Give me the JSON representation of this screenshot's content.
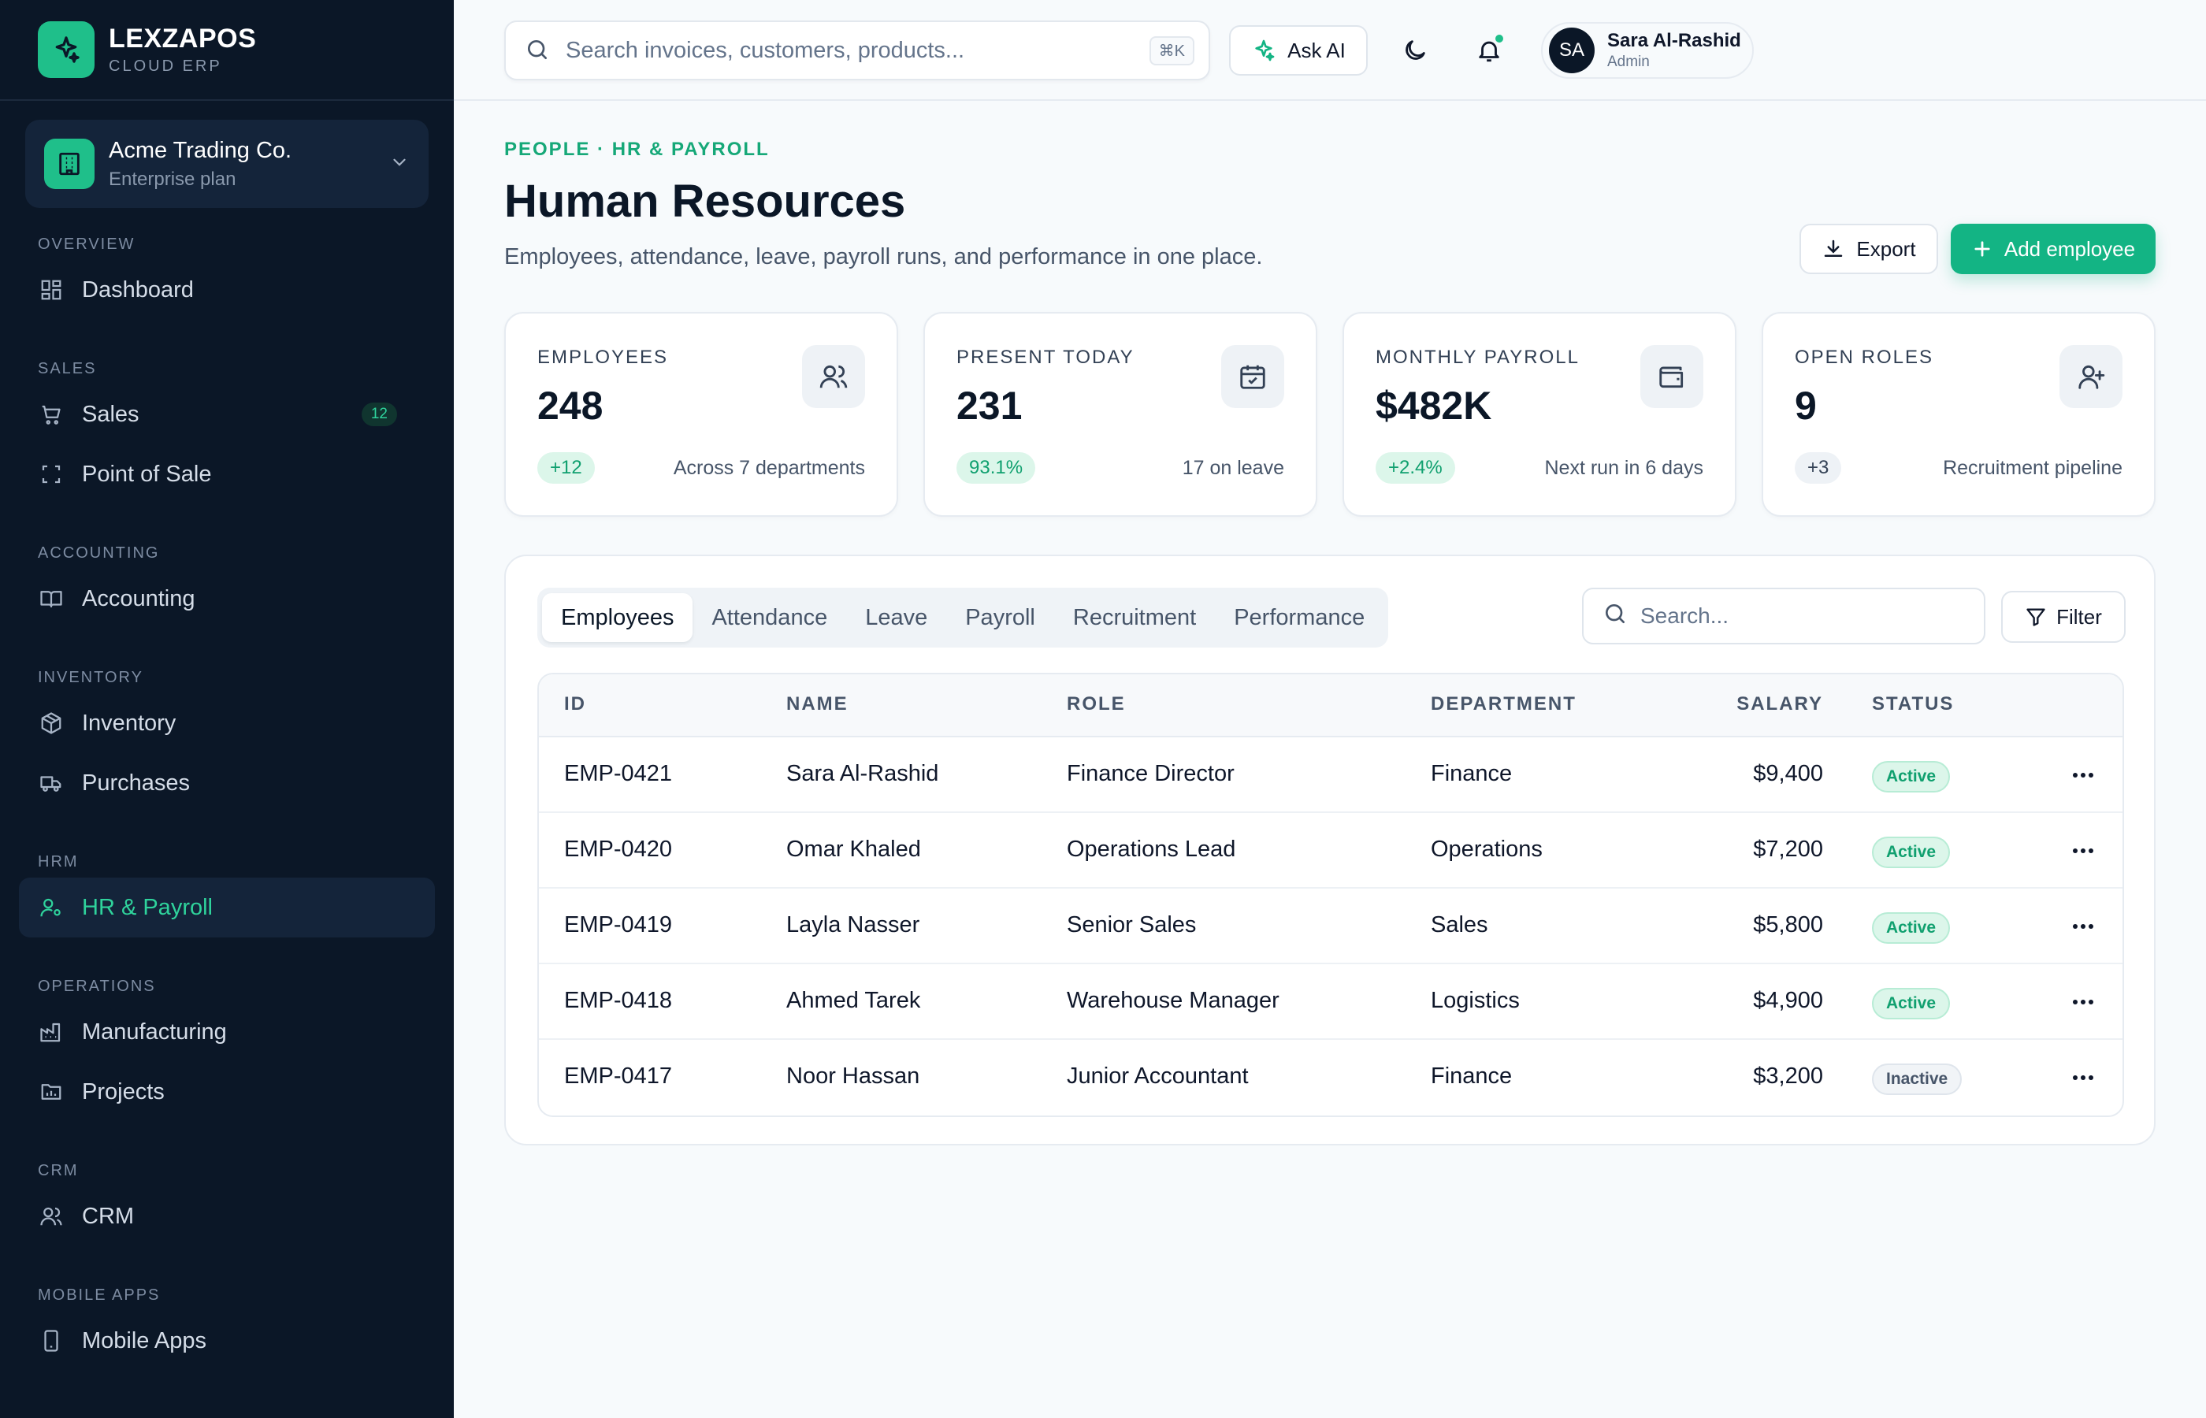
{
  "brand": {
    "name": "LEXZAPOS",
    "sub": "CLOUD ERP"
  },
  "org": {
    "name": "Acme Trading Co.",
    "plan": "Enterprise plan"
  },
  "nav": {
    "overview": "OVERVIEW",
    "dashboard": "Dashboard",
    "sales_section": "SALES",
    "sales": "Sales",
    "sales_badge": "12",
    "pos": "Point of Sale",
    "accounting_section": "ACCOUNTING",
    "accounting": "Accounting",
    "inventory_section": "INVENTORY",
    "inventory": "Inventory",
    "purchases": "Purchases",
    "hrm_section": "HRM",
    "hr": "HR & Payroll",
    "operations_section": "OPERATIONS",
    "manufacturing": "Manufacturing",
    "projects": "Projects",
    "crm_section": "CRM",
    "crm": "CRM",
    "mobile_section": "MOBILE APPS",
    "mobile": "Mobile Apps"
  },
  "topbar": {
    "search_placeholder": "Search invoices, customers, products...",
    "shortcut": "⌘K",
    "ask_ai": "Ask AI",
    "user": {
      "initials": "SA",
      "name": "Sara Al-Rashid",
      "role": "Admin"
    }
  },
  "page": {
    "breadcrumb": "PEOPLE · HR & PAYROLL",
    "title": "Human Resources",
    "subtitle": "Employees, attendance, leave, payroll runs, and performance in one place.",
    "export": "Export",
    "add": "Add employee"
  },
  "kpis": [
    {
      "label": "EMPLOYEES",
      "value": "248",
      "delta": "+12",
      "note": "Across 7 departments",
      "icon": "users-icon"
    },
    {
      "label": "PRESENT TODAY",
      "value": "231",
      "delta": "93.1%",
      "note": "17 on leave",
      "icon": "calendar-check-icon"
    },
    {
      "label": "MONTHLY PAYROLL",
      "value": "$482K",
      "delta": "+2.4%",
      "note": "Next run in 6 days",
      "icon": "wallet-icon"
    },
    {
      "label": "OPEN ROLES",
      "value": "9",
      "delta": "+3",
      "note": "Recruitment pipeline",
      "icon": "user-plus-icon"
    }
  ],
  "tabs": [
    "Employees",
    "Attendance",
    "Leave",
    "Payroll",
    "Recruitment",
    "Performance"
  ],
  "table": {
    "search_placeholder": "Search...",
    "filter": "Filter",
    "headers": {
      "id": "ID",
      "name": "NAME",
      "role": "ROLE",
      "department": "DEPARTMENT",
      "salary": "SALARY",
      "status": "STATUS"
    },
    "rows": [
      {
        "id": "EMP-0421",
        "name": "Sara Al-Rashid",
        "role": "Finance Director",
        "department": "Finance",
        "salary": "$9,400",
        "status": "Active"
      },
      {
        "id": "EMP-0420",
        "name": "Omar Khaled",
        "role": "Operations Lead",
        "department": "Operations",
        "salary": "$7,200",
        "status": "Active"
      },
      {
        "id": "EMP-0419",
        "name": "Layla Nasser",
        "role": "Senior Sales",
        "department": "Sales",
        "salary": "$5,800",
        "status": "Active"
      },
      {
        "id": "EMP-0418",
        "name": "Ahmed Tarek",
        "role": "Warehouse Manager",
        "department": "Logistics",
        "salary": "$4,900",
        "status": "Active"
      },
      {
        "id": "EMP-0417",
        "name": "Noor Hassan",
        "role": "Junior Accountant",
        "department": "Finance",
        "salary": "$3,200",
        "status": "Inactive"
      }
    ]
  },
  "colors": {
    "accent": "#13b484",
    "sidebar": "#0b1727",
    "active_status": "#10a06f"
  }
}
